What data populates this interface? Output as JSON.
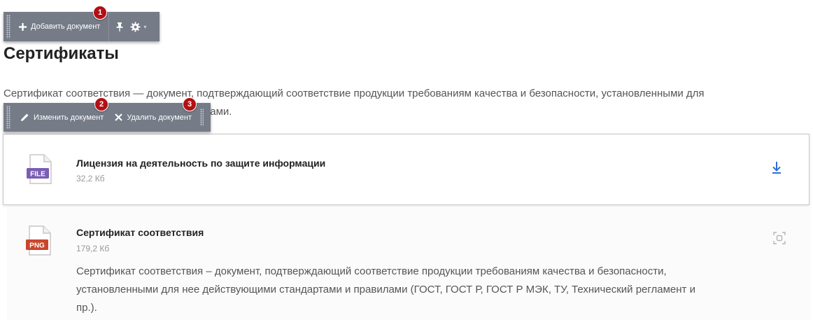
{
  "top_toolbar": {
    "add_label": "Добавить документ",
    "badge": "1"
  },
  "page": {
    "title": "Сертификаты",
    "intro_line1": "Сертификат соответствия — документ, подтверждающий соответствие продукции требованиям качества и безопасности, установленными для",
    "intro_line2": "нее действующими стандартами и правилами."
  },
  "item_toolbar": {
    "edit_label": "Изменить документ",
    "delete_label": "Удалить документ",
    "badge_edit": "2",
    "badge_delete": "3"
  },
  "documents": [
    {
      "ext": "FILE",
      "ext_color": "#7a5db5",
      "title": "Лицензия на деятельность по защите информации",
      "size": "32,2 Кб"
    },
    {
      "ext": "PNG",
      "ext_color": "#c9462c",
      "title": "Сертификат соответствия",
      "size": "179,2 Кб",
      "desc_line1": "Сертификат соответствия – документ, подтверждающий соответствие продукции требованиям качества и безопасности,",
      "desc_line2": "установленными для нее действующими стандартами и правилами (ГОСТ, ГОСТ Р, ГОСТ Р МЭК, ТУ, Технический регламент и",
      "desc_line3": "пр.)."
    }
  ],
  "colors": {
    "toolbar_bg": "#757b87",
    "badge_red": "#b30f14",
    "download_blue": "#2f6fd6"
  }
}
